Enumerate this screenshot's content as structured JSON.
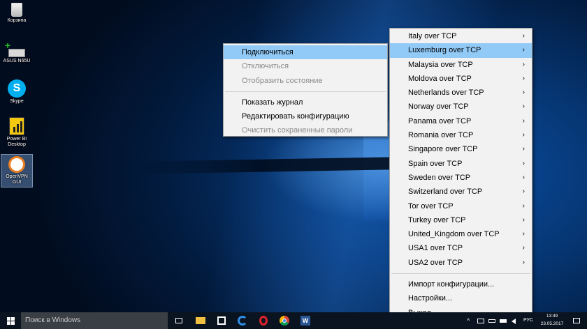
{
  "desktop": {
    "icons": [
      {
        "label": "Корзина",
        "icon": "recycle-bin-icon"
      },
      {
        "label": "ASUS N65U",
        "icon": "drive-icon"
      },
      {
        "label": "Skype",
        "icon": "skype-icon"
      },
      {
        "label": "Power BI Desktop",
        "icon": "powerbi-icon"
      },
      {
        "label": "OpenVPN GUI",
        "icon": "openvpn-icon"
      }
    ]
  },
  "context_menu": {
    "items": [
      {
        "label": "Подключиться",
        "state": "highlighted"
      },
      {
        "label": "Отключиться",
        "state": "disabled"
      },
      {
        "label": "Отобразить состояние",
        "state": "disabled"
      },
      {
        "label": "Показать журнал",
        "state": "enabled"
      },
      {
        "label": "Редактировать конфигурацию",
        "state": "enabled"
      },
      {
        "label": "Очистить сохраненные пароли",
        "state": "disabled"
      }
    ]
  },
  "server_menu": {
    "servers": [
      "Italy over TCP",
      "Luxemburg over TCP",
      "Malaysia over TCP",
      "Moldova over TCP",
      "Netherlands over TCP",
      "Norway over TCP",
      "Panama over TCP",
      "Romania over TCP",
      "Singapore over TCP",
      "Spain over TCP",
      "Sweden over TCP",
      "Switzerland over TCP",
      "Tor over TCP",
      "Turkey over TCP",
      "United_Kingdom over TCP",
      "USA1 over TCP",
      "USA2 over TCP"
    ],
    "highlighted": "Luxemburg over TCP",
    "actions": [
      "Импорт конфигурации...",
      "Настройки...",
      "Выход"
    ]
  },
  "taskbar": {
    "search_placeholder": "Поиск в Windows",
    "language": "РУС",
    "time": "13:49",
    "date": "23.05.2017",
    "pinned_icons": [
      "task-view-icon",
      "file-explorer-icon",
      "store-icon",
      "edge-icon",
      "opera-icon",
      "chrome-icon",
      "word-icon"
    ]
  },
  "colors": {
    "menu_highlight": "#91c9f7",
    "menu_background": "#f2f2f2",
    "taskbar": "#0a1420"
  }
}
